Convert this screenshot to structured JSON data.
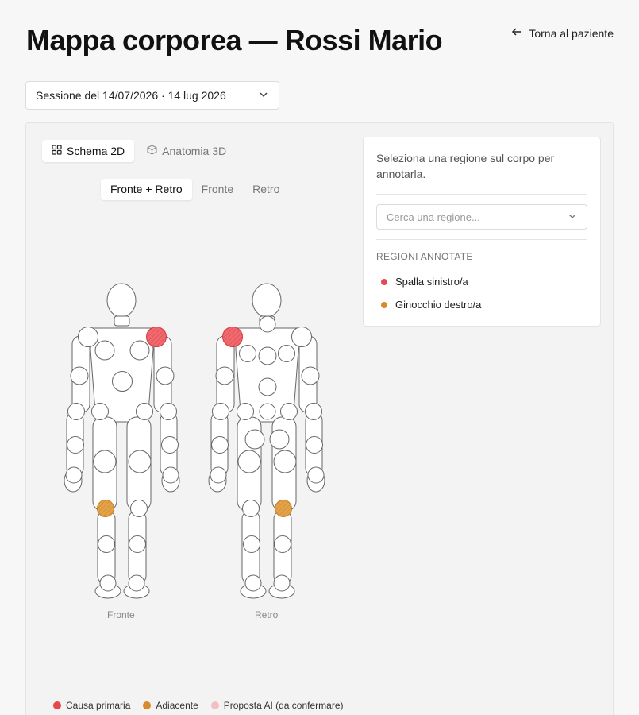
{
  "header": {
    "title": "Mappa corporea — Rossi Mario",
    "back_label": "Torna al paziente"
  },
  "session": {
    "selected": "Sessione del 14/07/2026 · 14 lug 2026"
  },
  "view_tabs": [
    {
      "label": "Schema 2D",
      "icon": "grid-icon",
      "active": true
    },
    {
      "label": "Anatomia 3D",
      "icon": "cube-icon",
      "active": false
    }
  ],
  "side_tabs": [
    {
      "label": "Fronte + Retro",
      "active": true
    },
    {
      "label": "Fronte",
      "active": false
    },
    {
      "label": "Retro",
      "active": false
    }
  ],
  "figures": {
    "front_label": "Fronte",
    "back_label": "Retro"
  },
  "panel": {
    "hint": "Seleziona una regione sul corpo per annotarla.",
    "search_placeholder": "Cerca una regione...",
    "annotated_title": "REGIONI ANNOTATE",
    "annotated": [
      {
        "label": "Spalla sinistro/a",
        "color": "#e5484d"
      },
      {
        "label": "Ginocchio destro/a",
        "color": "#d98b2b"
      }
    ]
  },
  "legend": [
    {
      "label": "Causa primaria",
      "color": "#e5484d"
    },
    {
      "label": "Adiacente",
      "color": "#d98b2b"
    },
    {
      "label": "Proposta AI (da confermare)",
      "color": "#f2c0c0"
    }
  ],
  "colors": {
    "primary": "#e5484d",
    "adjacent": "#d98b2b",
    "ai_proposal": "#f2c0c0"
  }
}
